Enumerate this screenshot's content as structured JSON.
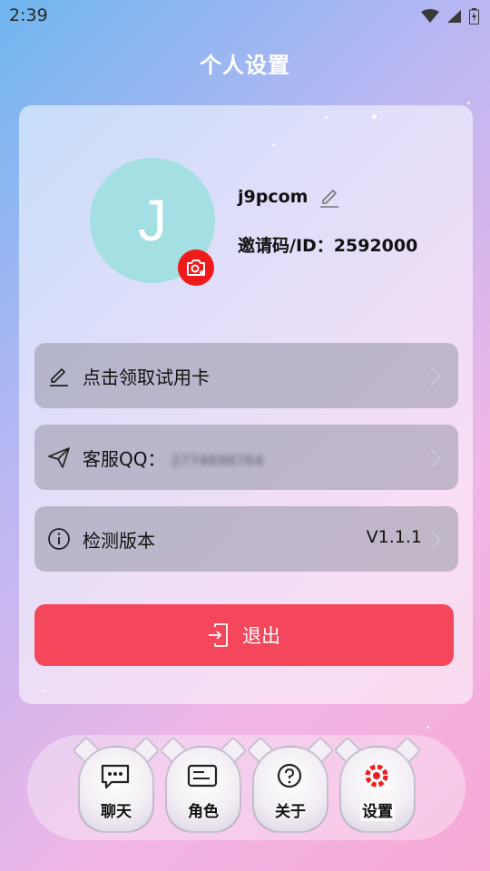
{
  "status": {
    "time": "2:39",
    "icons": [
      "wifi-icon",
      "signal-icon",
      "battery-icon"
    ]
  },
  "header": {
    "title": "个人设置"
  },
  "profile": {
    "avatar_initial": "J",
    "avatar_color": "#a3dfe3",
    "username": "j9pcom",
    "invite_code": "邀请码/ID：2592000"
  },
  "menu": {
    "trial_card": "点击领取试用卡",
    "service_label": "客服QQ：",
    "service_value": "2774698764",
    "check_version": "检测版本",
    "version": "V1.1.1"
  },
  "logout": {
    "label": "退出",
    "color": "#f4475c"
  },
  "tabs": [
    {
      "label": "聊天",
      "icon": "chat-icon"
    },
    {
      "label": "角色",
      "icon": "id-card-icon"
    },
    {
      "label": "关于",
      "icon": "help-icon"
    },
    {
      "label": "设置",
      "icon": "settings-icon",
      "active": true
    }
  ]
}
